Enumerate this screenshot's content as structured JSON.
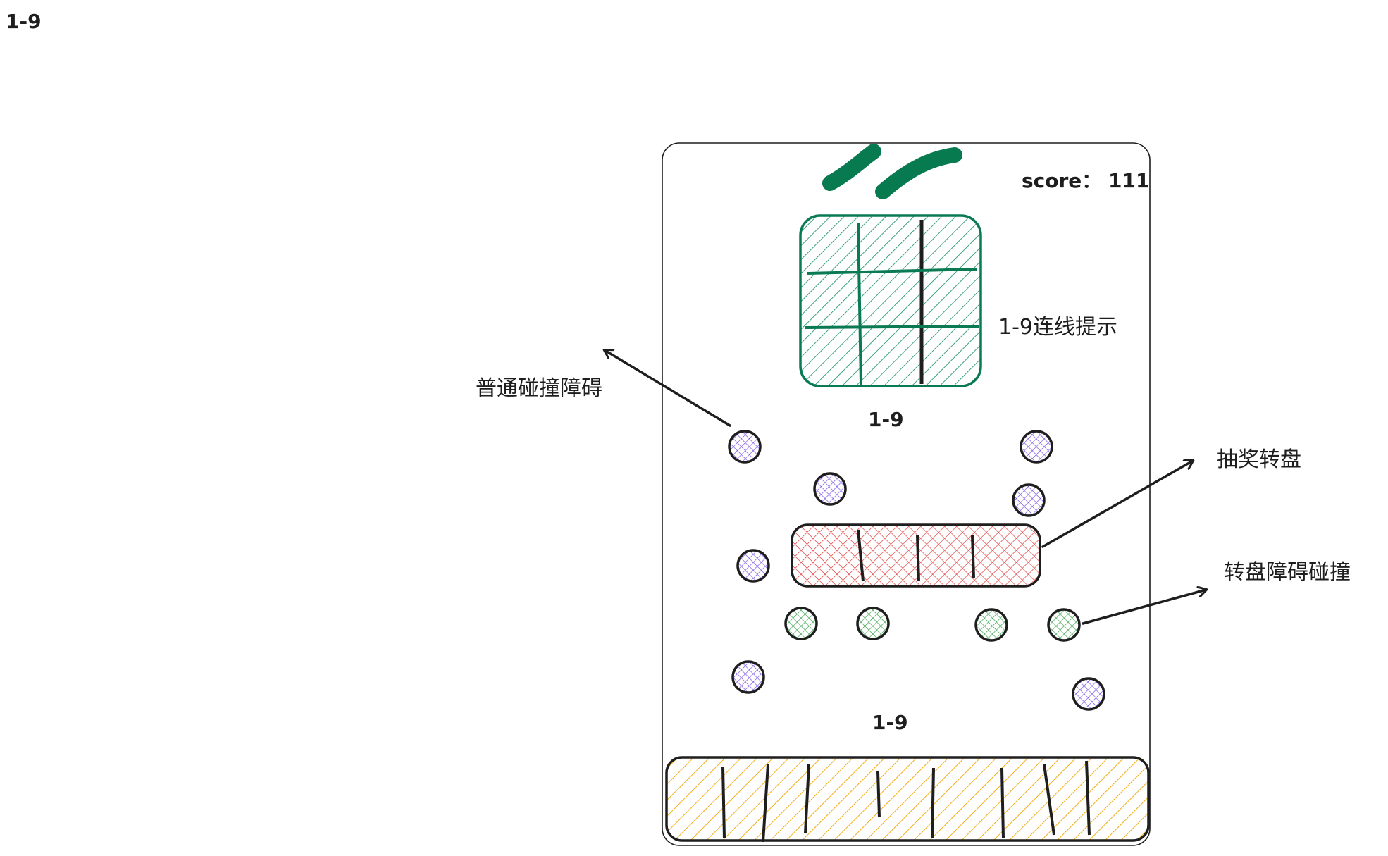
{
  "corner_label": "1-9",
  "board": {
    "score_text": "score： 111",
    "grid_hint_label": "1-9连线提示",
    "upper_number": "1-9",
    "lower_number": "1-9"
  },
  "annotations": {
    "normal_obstacle": "普通碰撞障碍",
    "lottery_wheel": "抽奖转盘",
    "wheel_obstacle": "转盘障碍碰撞"
  },
  "colors": {
    "stroke": "#1e1e1e",
    "grid_fill": "#0c8a5a",
    "grid_border": "#0a7a53",
    "logo": "#087a50",
    "wheel_fill": "#e03131",
    "slot_fill": "#f0a500",
    "purple_obstacle": "#7048e8",
    "green_obstacle": "#2f9e44"
  }
}
